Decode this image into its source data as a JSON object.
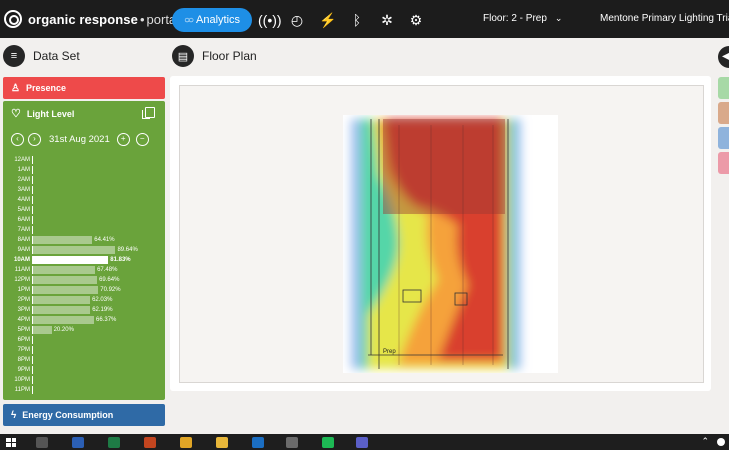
{
  "app": {
    "brand_name": "organic response",
    "brand_sep": "•",
    "brand_sub": "portal",
    "analytics_label": "Analytics",
    "floor_label": "Floor: 2 - Prep",
    "site_name": "Mentone Primary Lighting Trial"
  },
  "top_icons": [
    "wireless-icon",
    "gauge-icon",
    "plug-icon",
    "bluetooth-icon",
    "bulb-settings-icon",
    "gears-icon"
  ],
  "left": {
    "title": "Data Set",
    "presence_label": "Presence",
    "light_level_label": "Light Level",
    "date": "31st Aug 2021",
    "energy_label": "Energy Consumption",
    "hours": [
      {
        "label": "12AM",
        "value": null,
        "text": ""
      },
      {
        "label": "1AM",
        "value": null,
        "text": ""
      },
      {
        "label": "2AM",
        "value": null,
        "text": ""
      },
      {
        "label": "3AM",
        "value": null,
        "text": ""
      },
      {
        "label": "4AM",
        "value": null,
        "text": ""
      },
      {
        "label": "5AM",
        "value": null,
        "text": ""
      },
      {
        "label": "6AM",
        "value": null,
        "text": ""
      },
      {
        "label": "7AM",
        "value": null,
        "text": ""
      },
      {
        "label": "8AM",
        "value": 64.41,
        "text": "64.41%"
      },
      {
        "label": "9AM",
        "value": 89.64,
        "text": "89.64%"
      },
      {
        "label": "10AM",
        "value": 81.83,
        "text": "81.83%",
        "active": true
      },
      {
        "label": "11AM",
        "value": 67.48,
        "text": "67.48%"
      },
      {
        "label": "12PM",
        "value": 69.64,
        "text": "69.64%"
      },
      {
        "label": "1PM",
        "value": 70.92,
        "text": "70.92%"
      },
      {
        "label": "2PM",
        "value": 62.03,
        "text": "62.03%"
      },
      {
        "label": "3PM",
        "value": 62.19,
        "text": "62.19%"
      },
      {
        "label": "4PM",
        "value": 66.37,
        "text": "66.37%"
      },
      {
        "label": "5PM",
        "value": 20.2,
        "text": "20.20%"
      },
      {
        "label": "6PM",
        "value": null,
        "text": ""
      },
      {
        "label": "7PM",
        "value": null,
        "text": ""
      },
      {
        "label": "8PM",
        "value": null,
        "text": ""
      },
      {
        "label": "9PM",
        "value": null,
        "text": ""
      },
      {
        "label": "10PM",
        "value": null,
        "text": ""
      },
      {
        "label": "11PM",
        "value": null,
        "text": ""
      }
    ]
  },
  "main": {
    "title": "Floor Plan",
    "room_label": "Prep"
  },
  "colors": {
    "topbar": "#1c1c1c",
    "accent": "#1e8fe6",
    "presence": "#ee4a4a",
    "light_level": "#6aa33b",
    "energy": "#2f6aa6",
    "right_tabs": [
      "#a7d9a6",
      "#d9a98a",
      "#8fb3dc",
      "#ec9aa8"
    ]
  },
  "taskbar_icons": [
    {
      "name": "taskview-icon",
      "color": "#555555"
    },
    {
      "name": "word-icon",
      "color": "#2b5fb4"
    },
    {
      "name": "excel-icon",
      "color": "#1e7b45"
    },
    {
      "name": "app-icon",
      "color": "#c2451f"
    },
    {
      "name": "chrome-icon",
      "color": "#e0a526"
    },
    {
      "name": "folder-icon",
      "color": "#e8b73a"
    },
    {
      "name": "outlook-icon",
      "color": "#1b6ec2"
    },
    {
      "name": "calculator-icon",
      "color": "#6b6b6b"
    },
    {
      "name": "spotify-icon",
      "color": "#1db954"
    },
    {
      "name": "teams-icon",
      "color": "#5b5fc7"
    }
  ]
}
